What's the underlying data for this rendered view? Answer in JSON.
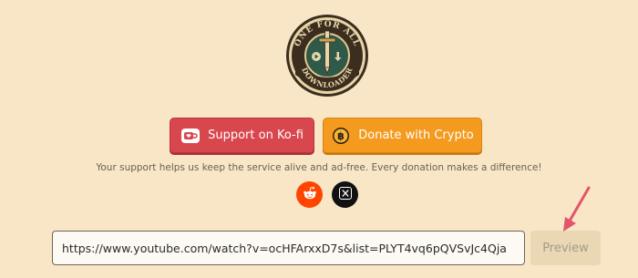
{
  "logo": {
    "top_text": "ONE FOR ALL",
    "bottom_text": "DOWNLOADER"
  },
  "buttons": {
    "kofi_label": "Support on Ko-fi",
    "crypto_label": "Donate with Crypto"
  },
  "support_message": "Your support helps us keep the service alive and ad-free. Every donation makes a difference!",
  "social": [
    "reddit-icon",
    "x-icon"
  ],
  "url_input": {
    "value": "https://www.youtube.com/watch?v=ocHFArxxD7s&list=PLYT4vq6pQVSvJc4Qja"
  },
  "preview_label": "Preview",
  "colors": {
    "background": "#f8e6c6",
    "kofi": "#d9474e",
    "crypto": "#f49a1f",
    "reddit": "#ff4500",
    "arrow": "#e2556a"
  }
}
